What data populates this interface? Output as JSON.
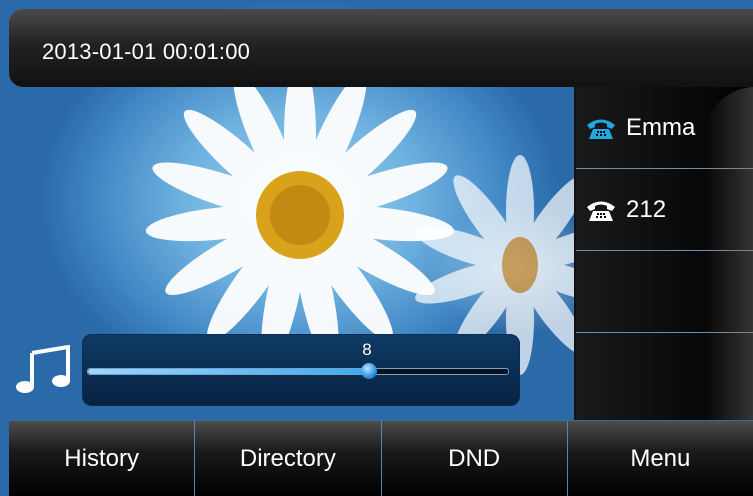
{
  "status_bar": {
    "datetime": "2013-01-01 00:01:00"
  },
  "line_keys": [
    {
      "label": "Emma",
      "icon": "phone-icon",
      "color": "#22a8e0"
    },
    {
      "label": "212",
      "icon": "phone-icon",
      "color": "#ffffff"
    },
    {
      "label": ""
    },
    {
      "label": ""
    }
  ],
  "volume": {
    "icon": "music-note-icon",
    "value": "8",
    "level_fraction": 0.67
  },
  "soft_keys": [
    "History",
    "Directory",
    "DND",
    "Menu"
  ]
}
